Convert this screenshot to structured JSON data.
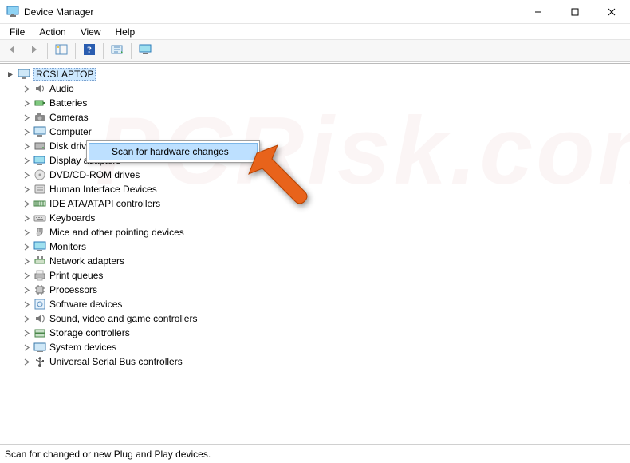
{
  "window": {
    "title": "Device Manager"
  },
  "menubar": {
    "items": [
      "File",
      "Action",
      "View",
      "Help"
    ]
  },
  "toolbar": {
    "buttons": [
      {
        "name": "back-button",
        "icon": "arrow-left-icon"
      },
      {
        "name": "forward-button",
        "icon": "arrow-right-icon"
      },
      {
        "name": "show-hide-tree-button",
        "icon": "tree-pane-icon"
      },
      {
        "name": "help-button",
        "icon": "help-icon"
      },
      {
        "name": "scan-hardware-button",
        "icon": "scan-icon"
      },
      {
        "name": "monitor-button",
        "icon": "display-icon"
      }
    ]
  },
  "tree": {
    "root": {
      "label": "RCSLAPTOP",
      "expanded": true
    },
    "categories": [
      {
        "label": "Audio"
      },
      {
        "label": "Batteries"
      },
      {
        "label": "Cameras"
      },
      {
        "label": "Computer"
      },
      {
        "label": "Disk drives"
      },
      {
        "label": "Display adapters"
      },
      {
        "label": "DVD/CD-ROM drives"
      },
      {
        "label": "Human Interface Devices"
      },
      {
        "label": "IDE ATA/ATAPI controllers"
      },
      {
        "label": "Keyboards"
      },
      {
        "label": "Mice and other pointing devices"
      },
      {
        "label": "Monitors"
      },
      {
        "label": "Network adapters"
      },
      {
        "label": "Print queues"
      },
      {
        "label": "Processors"
      },
      {
        "label": "Software devices"
      },
      {
        "label": "Sound, video and game controllers"
      },
      {
        "label": "Storage controllers"
      },
      {
        "label": "System devices"
      },
      {
        "label": "Universal Serial Bus controllers"
      }
    ]
  },
  "context_menu": {
    "items": [
      {
        "label": "Scan for hardware changes",
        "highlighted": true
      }
    ]
  },
  "statusbar": {
    "text": "Scan for changed or new Plug and Play devices."
  },
  "watermark": "PCRisk.com"
}
